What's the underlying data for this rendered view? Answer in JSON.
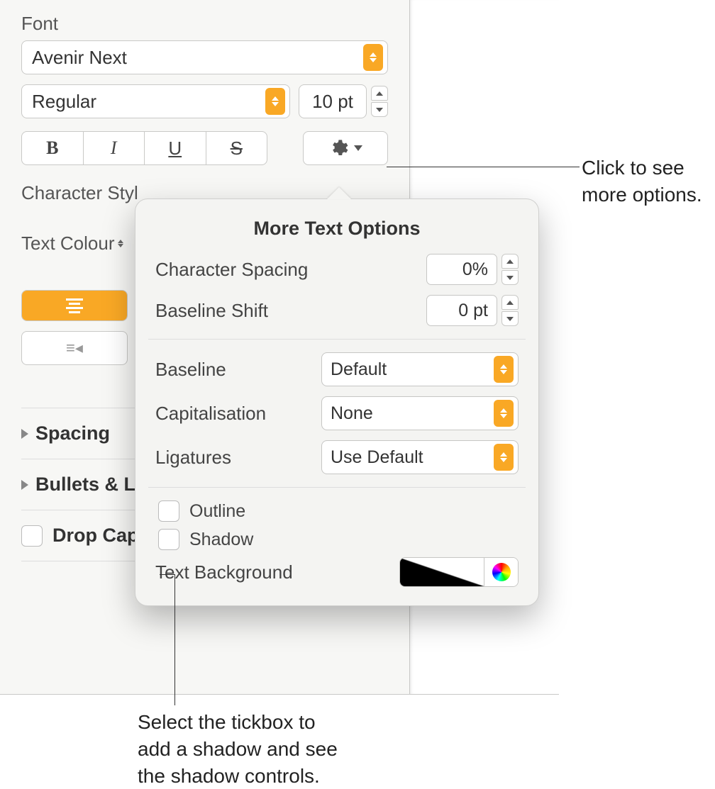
{
  "sidebar": {
    "font_section_label": "Font",
    "font_family": "Avenir Next",
    "font_face": "Regular",
    "font_size": "10 pt",
    "bold_glyph": "B",
    "italic_glyph": "I",
    "underline_glyph": "U",
    "strike_glyph": "S",
    "character_styles_label": "Character Styl",
    "text_colour_label": "Text Colour",
    "spacing_label": "Spacing",
    "bullets_label": "Bullets & Li",
    "drop_cap_label": "Drop Cap"
  },
  "popover": {
    "title": "More Text Options",
    "char_spacing_label": "Character Spacing",
    "char_spacing_value": "0%",
    "baseline_shift_label": "Baseline Shift",
    "baseline_shift_value": "0 pt",
    "baseline_label": "Baseline",
    "baseline_value": "Default",
    "capitalisation_label": "Capitalisation",
    "capitalisation_value": "None",
    "ligatures_label": "Ligatures",
    "ligatures_value": "Use Default",
    "outline_label": "Outline",
    "shadow_label": "Shadow",
    "text_bg_label": "Text Background"
  },
  "callouts": {
    "right_line1": "Click to see",
    "right_line2": "more options.",
    "bottom_line1": "Select the tickbox to",
    "bottom_line2": "add a shadow and see",
    "bottom_line3": "the shadow controls."
  }
}
